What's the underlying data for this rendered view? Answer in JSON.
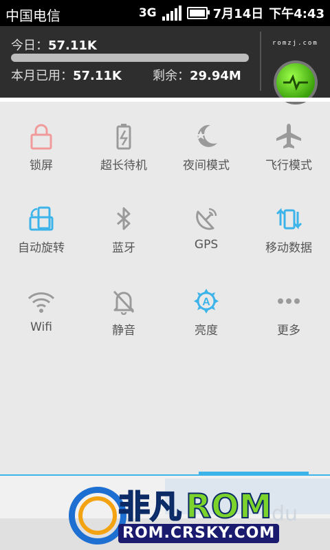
{
  "status_bar": {
    "carrier": "中国电信",
    "network": "3G",
    "date": "7月14日",
    "time": "下午4:43"
  },
  "traffic": {
    "today_label": "今日：",
    "today_value": "57.11K",
    "month_label": "本月已用：",
    "month_value": "57.11K",
    "remain_label": "剩余：",
    "remain_value": "29.94M",
    "site": "romzj.com",
    "usage_fraction": 0.002
  },
  "toggles": [
    {
      "label": "锁屏",
      "icon": "lock-icon",
      "color": "#f19a9a"
    },
    {
      "label": "超长待机",
      "icon": "battery-saver-icon",
      "color": "#9a9a9a"
    },
    {
      "label": "夜间模式",
      "icon": "night-mode-icon",
      "color": "#9a9a9a"
    },
    {
      "label": "飞行模式",
      "icon": "airplane-icon",
      "color": "#9a9a9a"
    },
    {
      "label": "自动旋转",
      "icon": "auto-rotate-icon",
      "color": "#3cb4ea"
    },
    {
      "label": "蓝牙",
      "icon": "bluetooth-icon",
      "color": "#9a9a9a"
    },
    {
      "label": "GPS",
      "icon": "gps-icon",
      "color": "#9a9a9a"
    },
    {
      "label": "移动数据",
      "icon": "mobile-data-icon",
      "color": "#3cb4ea"
    },
    {
      "label": "Wifi",
      "icon": "wifi-icon",
      "color": "#9a9a9a"
    },
    {
      "label": "静音",
      "icon": "silent-icon",
      "color": "#9a9a9a"
    },
    {
      "label": "亮度",
      "icon": "brightness-icon",
      "color": "#3cb4ea"
    },
    {
      "label": "更多",
      "icon": "more-icon",
      "color": "#9a9a9a"
    }
  ],
  "watermark": {
    "fei": "非凡",
    "rom": "ROM",
    "url": "ROM.CRSKY.COM",
    "du": "du"
  },
  "colors": {
    "accent": "#3cb4ea",
    "panel_bg": "#2e2e2e",
    "grid_bg": "#e9e9e9"
  }
}
